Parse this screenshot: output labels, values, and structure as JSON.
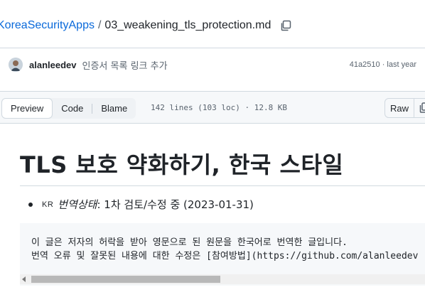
{
  "breadcrumb": {
    "repo": "KoreaSecurityApps",
    "separator": "/",
    "file": "03_weakening_tls_protection.md"
  },
  "commit": {
    "author": "alanleedev",
    "message": "인증서 목록 링크 추가",
    "sha": "41a2510",
    "meta_sep": "·",
    "time": "last year"
  },
  "toolbar": {
    "preview": "Preview",
    "code": "Code",
    "blame": "Blame",
    "file_info": "142 lines (103 loc) · 12.8 KB",
    "raw": "Raw"
  },
  "document": {
    "title": "TLS 보호 약화하기, 한국 스타일",
    "status_flag": "KR",
    "status_label": "번역상태",
    "status_value": ": 1차 검토/수정 중 (2023-01-31)",
    "code_lines": [
      "이 글은 저자의 허락을 받아 영문으로 된 원문을 한국어로 번역한 글입니다.",
      "번역 오류 및 잘못된 내용에 대한 수정은 [참여방법](https://github.com/alanleedev"
    ]
  },
  "colors": {
    "link": "#0969da",
    "muted": "#59636e",
    "border": "#d1d9e0",
    "toolbar_bg": "#f6f8fa"
  },
  "icons": {
    "copy_path": "copy-icon",
    "copy_raw": "copy-icon"
  }
}
